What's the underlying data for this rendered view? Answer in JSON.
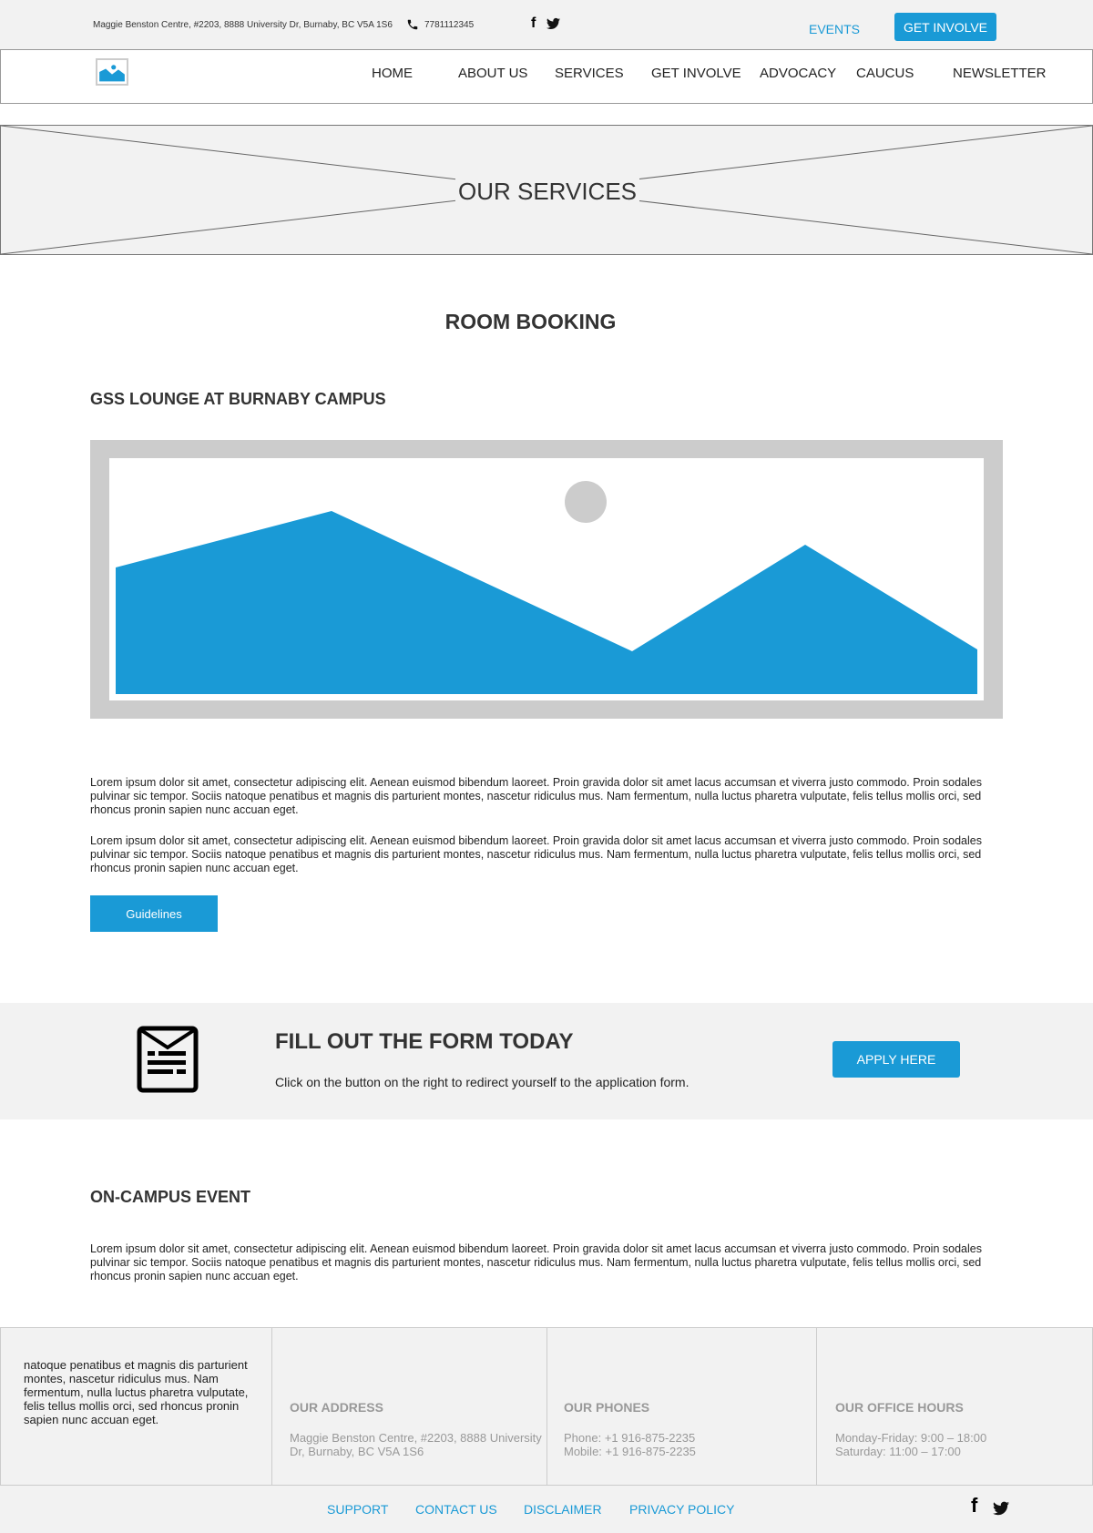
{
  "topbar": {
    "address": "Maggie Benston Centre, #2203, 8888 University Dr, Burnaby, BC V5A 1S6",
    "phone": "7781112345",
    "events_label": "EVENTS",
    "get_involve_label": "GET INVOLVE"
  },
  "nav": {
    "items": [
      "HOME",
      "ABOUT US",
      "SERVICES",
      "GET INVOLVE",
      "ADVOCACY",
      "CAUCUS",
      "NEWSLETTER"
    ]
  },
  "hero": {
    "title": "OUR SERVICES"
  },
  "main": {
    "section_title": "ROOM BOOKING",
    "subsection_title": "GSS LOUNGE AT BURNABY CAMPUS",
    "paragraphs": [
      "Lorem ipsum dolor sit amet, consectetur adipiscing elit. Aenean euismod bibendum laoreet. Proin gravida dolor sit amet lacus accumsan et viverra justo commodo. Proin sodales pulvinar sic tempor. Sociis natoque penatibus et magnis dis parturient montes, nascetur ridiculus mus. Nam fermentum, nulla luctus pharetra vulputate, felis tellus mollis orci, sed rhoncus pronin sapien nunc accuan eget.",
      "Lorem ipsum dolor sit amet, consectetur adipiscing elit. Aenean euismod bibendum laoreet. Proin gravida dolor sit amet lacus accumsan et viverra justo commodo. Proin sodales pulvinar sic tempor. Sociis natoque penatibus et magnis dis parturient montes, nascetur ridiculus mus. Nam fermentum, nulla luctus pharetra vulputate, felis tellus mollis orci, sed rhoncus pronin sapien nunc accuan eget."
    ],
    "guidelines_label": "Guidelines"
  },
  "cta": {
    "title": "FILL OUT THE FORM TODAY",
    "text": "Click on the button on the right to redirect yourself to the application form.",
    "button_label": "APPLY HERE"
  },
  "oncampus": {
    "title": "ON-CAMPUS EVENT",
    "paragraph": "Lorem ipsum dolor sit amet, consectetur adipiscing elit. Aenean euismod bibendum laoreet. Proin gravida dolor sit amet lacus accumsan et viverra justo commodo. Proin sodales pulvinar sic tempor. Sociis natoque penatibus et magnis dis parturient montes, nascetur ridiculus mus. Nam fermentum, nulla luctus pharetra vulputate, felis tellus mollis orci, sed rhoncus pronin sapien nunc accuan eget."
  },
  "footer": {
    "about_text": "natoque penatibus et magnis dis parturient montes, nascetur ridiculus mus. Nam fermentum, nulla luctus pharetra vulputate, felis tellus mollis orci, sed rhoncus pronin sapien nunc accuan eget.",
    "address_heading": "OUR ADDRESS",
    "address_line1": "Maggie Benston Centre, #2203, 8888 University",
    "address_line2": "Dr, Burnaby, BC V5A 1S6",
    "phones_heading": "OUR PHONES",
    "phone_line": "Phone: +1 916-875-2235",
    "mobile_line": "Mobile: +1 916-875-2235",
    "hours_heading": "OUR OFFICE HOURS",
    "hours_weekday": "Monday-Friday: 9:00 – 18:00",
    "hours_saturday": "Saturday: 11:00 – 17:00",
    "links": [
      "SUPPORT",
      "CONTACT US",
      "DISCLAIMER",
      "PRIVACY POLICY"
    ]
  },
  "icons": {
    "phone": "phone-icon",
    "facebook": "facebook-icon",
    "twitter": "twitter-icon",
    "logo": "image-placeholder-icon",
    "form": "form-icon"
  },
  "colors": {
    "accent": "#1a9ad6",
    "band_bg": "#f2f2f2",
    "text": "#333333",
    "muted": "#999999"
  }
}
